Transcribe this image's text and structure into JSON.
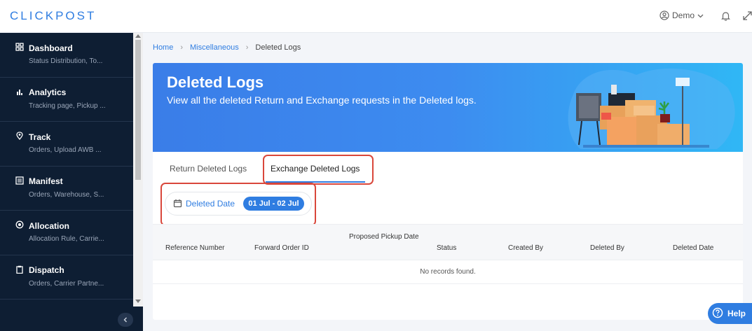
{
  "app": {
    "logo": "CLICKPOST"
  },
  "header": {
    "user_label": "Demo"
  },
  "sidebar": {
    "items": [
      {
        "label": "Dashboard",
        "sub": "Status Distribution, To..."
      },
      {
        "label": "Analytics",
        "sub": "Tracking page, Pickup ..."
      },
      {
        "label": "Track",
        "sub": "Orders, Upload AWB ..."
      },
      {
        "label": "Manifest",
        "sub": "Orders, Warehouse, S..."
      },
      {
        "label": "Allocation",
        "sub": "Allocation Rule, Carrie..."
      },
      {
        "label": "Dispatch",
        "sub": "Orders, Carrier Partne..."
      }
    ]
  },
  "breadcrumb": {
    "home": "Home",
    "section": "Miscellaneous",
    "current": "Deleted Logs"
  },
  "banner": {
    "title": "Deleted Logs",
    "subtitle": "View all the deleted Return and Exchange requests in the Deleted logs."
  },
  "tabs": [
    {
      "label": "Return Deleted Logs",
      "active": false
    },
    {
      "label": "Exchange Deleted Logs",
      "active": true
    }
  ],
  "filter": {
    "label": "Deleted Date",
    "value": "01 Jul - 02 Jul"
  },
  "table": {
    "columns": [
      "Reference Number",
      "Forward Order ID",
      "Proposed Pickup Date",
      "Status",
      "Created By",
      "Deleted By",
      "Deleted Date"
    ],
    "empty_text": "No records found."
  },
  "help": {
    "label": "Help"
  },
  "colors": {
    "accent": "#2f7de1",
    "sidebar": "#0e1e33",
    "highlight": "#d9473b"
  }
}
